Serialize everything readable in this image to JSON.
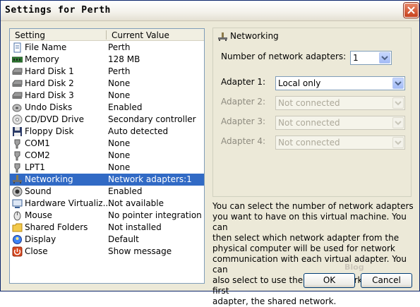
{
  "window": {
    "title": "Settings for Perth"
  },
  "list": {
    "col_setting": "Setting",
    "col_value": "Current Value",
    "rows": [
      {
        "name": "File Name",
        "value": "Perth",
        "icon": "file-icon"
      },
      {
        "name": "Memory",
        "value": "128 MB",
        "icon": "memory-icon"
      },
      {
        "name": "Hard Disk 1",
        "value": "Perth",
        "icon": "hard-disk-icon"
      },
      {
        "name": "Hard Disk 2",
        "value": "None",
        "icon": "hard-disk-icon"
      },
      {
        "name": "Hard Disk 3",
        "value": "None",
        "icon": "hard-disk-icon"
      },
      {
        "name": "Undo Disks",
        "value": "Enabled",
        "icon": "undo-disks-icon"
      },
      {
        "name": "CD/DVD Drive",
        "value": "Secondary controller",
        "icon": "cd-icon"
      },
      {
        "name": "Floppy Disk",
        "value": "Auto detected",
        "icon": "floppy-icon"
      },
      {
        "name": "COM1",
        "value": "None",
        "icon": "port-icon"
      },
      {
        "name": "COM2",
        "value": "None",
        "icon": "port-icon"
      },
      {
        "name": "LPT1",
        "value": "None",
        "icon": "port-icon"
      },
      {
        "name": "Networking",
        "value": "Network adapters:1",
        "icon": "network-icon",
        "selected": true
      },
      {
        "name": "Sound",
        "value": "Enabled",
        "icon": "sound-icon"
      },
      {
        "name": "Hardware Virtualiz...",
        "value": "Not available",
        "icon": "hardware-icon"
      },
      {
        "name": "Mouse",
        "value": "No pointer integration",
        "icon": "mouse-icon"
      },
      {
        "name": "Shared Folders",
        "value": "Not installed",
        "icon": "folder-icon"
      },
      {
        "name": "Display",
        "value": "Default",
        "icon": "display-icon"
      },
      {
        "name": "Close",
        "value": "Show message",
        "icon": "close-setting-icon"
      }
    ]
  },
  "networking": {
    "title": "Networking",
    "num_label": "Number of network adapters:",
    "num_value": "1",
    "adapters": [
      {
        "label": "Adapter 1:",
        "value": "Local only",
        "enabled": true
      },
      {
        "label": "Adapter 2:",
        "value": "Not connected",
        "enabled": false
      },
      {
        "label": "Adapter 3:",
        "value": "Not connected",
        "enabled": false
      },
      {
        "label": "Adapter 4:",
        "value": "Not connected",
        "enabled": false
      }
    ]
  },
  "description": {
    "lines": [
      "You can select the number of network adapters",
      "you want to have on this virtual machine. You can",
      "then select which network adapter from the",
      "physical computer will be used for network",
      "communication with each virtual adapter. You can",
      "also select to use the local network or, for the first",
      "adapter, the shared network."
    ]
  },
  "buttons": {
    "ok": "OK",
    "cancel": "Cancel"
  },
  "watermark": "Blog",
  "colors": {
    "selection": "#316AC5",
    "dialog_bg": "#ECE9D8",
    "border": "#7F9DB9"
  }
}
